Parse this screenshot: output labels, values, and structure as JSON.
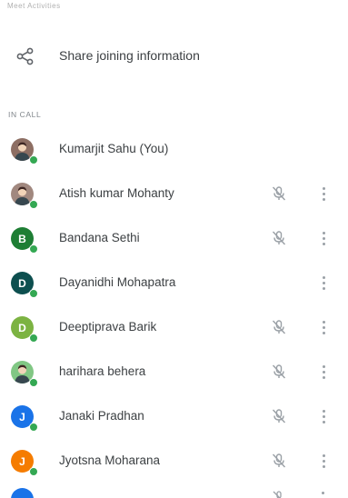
{
  "header": {
    "fragment_text": "Meet Activities"
  },
  "share": {
    "icon": "share-icon",
    "label": "Share joining information"
  },
  "in_call": {
    "section_label": "IN CALL",
    "participants": [
      {
        "name": "Kumarjit Sahu (You)",
        "initial": "",
        "avatar": "photo",
        "avatar_color": "#8d6e63",
        "muted": false,
        "has_menu": false
      },
      {
        "name": "Atish kumar Mohanty",
        "initial": "",
        "avatar": "photo",
        "avatar_color": "#a1887f",
        "muted": true,
        "has_menu": true
      },
      {
        "name": "Bandana Sethi",
        "initial": "B",
        "avatar": "letter",
        "avatar_color": "#1e7e34",
        "muted": true,
        "has_menu": true
      },
      {
        "name": "Dayanidhi Mohapatra",
        "initial": "D",
        "avatar": "letter",
        "avatar_color": "#0d4f4f",
        "muted": false,
        "has_menu": true
      },
      {
        "name": "Deeptiprava Barik",
        "initial": "D",
        "avatar": "letter",
        "avatar_color": "#7cb342",
        "muted": true,
        "has_menu": true
      },
      {
        "name": "harihara behera",
        "initial": "",
        "avatar": "photo",
        "avatar_color": "#81c784",
        "muted": true,
        "has_menu": true
      },
      {
        "name": "Janaki Pradhan",
        "initial": "J",
        "avatar": "letter",
        "avatar_color": "#1a73e8",
        "muted": true,
        "has_menu": true
      },
      {
        "name": "Jyotsna Moharana",
        "initial": "J",
        "avatar": "letter",
        "avatar_color": "#f57c00",
        "muted": true,
        "has_menu": true
      }
    ]
  },
  "icons": {
    "muted_mic": "mic-off-icon",
    "menu": "more-vert-icon",
    "presence": "presence-dot"
  },
  "colors": {
    "presence": "#34a853",
    "icon_gray": "#9aa0a6",
    "section_label": "#80868b"
  }
}
